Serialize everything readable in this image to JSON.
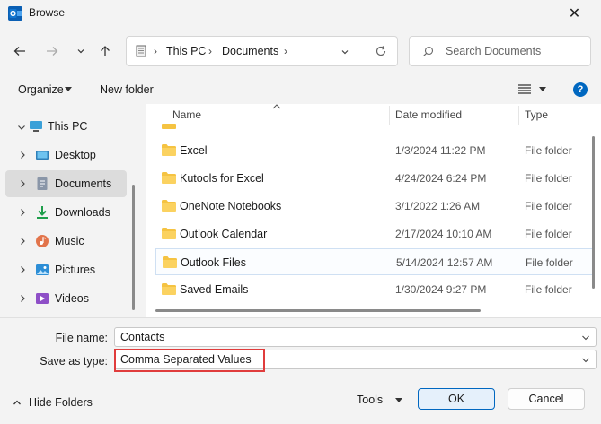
{
  "window": {
    "title": "Browse",
    "close_glyph": "✕"
  },
  "breadcrumb": [
    "This PC",
    "Documents"
  ],
  "search": {
    "placeholder": "Search Documents"
  },
  "toolbar": {
    "organize_label": "Organize",
    "new_folder_label": "New folder",
    "help_glyph": "?"
  },
  "nav": {
    "items": [
      {
        "label": "This PC",
        "icon": "pc-icon",
        "selected": false
      },
      {
        "label": "Desktop",
        "icon": "desktop-icon",
        "selected": false
      },
      {
        "label": "Documents",
        "icon": "documents-icon",
        "selected": true
      },
      {
        "label": "Downloads",
        "icon": "downloads-icon",
        "selected": false
      },
      {
        "label": "Music",
        "icon": "music-icon",
        "selected": false
      },
      {
        "label": "Pictures",
        "icon": "pictures-icon",
        "selected": false
      },
      {
        "label": "Videos",
        "icon": "videos-icon",
        "selected": false
      }
    ]
  },
  "columns": {
    "name": "Name",
    "date": "Date modified",
    "type": "Type"
  },
  "files": [
    {
      "name": "Excel",
      "date": "1/3/2024 11:22 PM",
      "type": "File folder",
      "selected": false
    },
    {
      "name": "Kutools for Excel",
      "date": "4/24/2024 6:24 PM",
      "type": "File folder",
      "selected": false
    },
    {
      "name": "OneNote Notebooks",
      "date": "3/1/2022 1:26 AM",
      "type": "File folder",
      "selected": false
    },
    {
      "name": "Outlook Calendar",
      "date": "2/17/2024 10:10 AM",
      "type": "File folder",
      "selected": false
    },
    {
      "name": "Outlook Files",
      "date": "5/14/2024 12:57 AM",
      "type": "File folder",
      "selected": true
    },
    {
      "name": "Saved Emails",
      "date": "1/30/2024 9:27 PM",
      "type": "File folder",
      "selected": false
    }
  ],
  "form": {
    "file_name_label": "File name:",
    "file_name_value": "Contacts",
    "save_type_label": "Save as type:",
    "save_type_value": "Comma Separated Values"
  },
  "footer": {
    "hide_folders_label": "Hide Folders",
    "tools_label": "Tools",
    "ok_label": "OK",
    "cancel_label": "Cancel"
  },
  "colors": {
    "accent": "#0067c0",
    "folder": "#f5c342",
    "highlight": "#e03c3c"
  }
}
